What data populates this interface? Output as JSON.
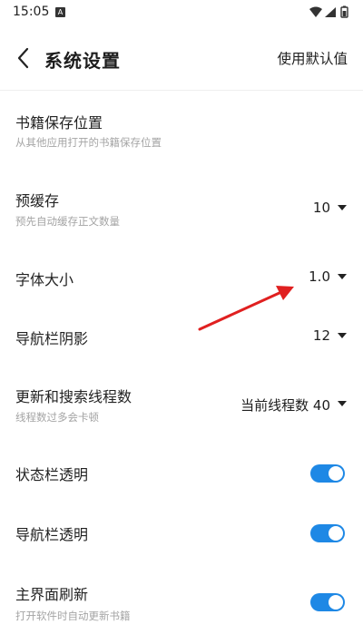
{
  "status_bar": {
    "time": "15:05",
    "notification_icon": "A"
  },
  "header": {
    "title": "系统设置",
    "action": "使用默认值",
    "back_icon": "chevron-left-icon"
  },
  "settings": [
    {
      "title": "书籍保存位置",
      "subtitle": "从其他应用打开的书籍保存位置"
    },
    {
      "title": "预缓存",
      "subtitle": "预先自动缓存正文数量",
      "value": "10"
    },
    {
      "title": "字体大小",
      "value": "1.0"
    },
    {
      "title": "导航栏阴影",
      "value": "12"
    },
    {
      "title": "更新和搜索线程数",
      "subtitle": "线程数过多会卡顿",
      "value": "当前线程数 40"
    },
    {
      "title": "状态栏透明",
      "toggle": true
    },
    {
      "title": "导航栏透明",
      "toggle": true
    },
    {
      "title": "主界面刷新",
      "subtitle": "打开软件时自动更新书籍",
      "toggle": true
    }
  ],
  "colors": {
    "accent": "#1e88e5",
    "annotation_arrow": "#e02020",
    "subtitle_text": "#a4a4a4"
  }
}
